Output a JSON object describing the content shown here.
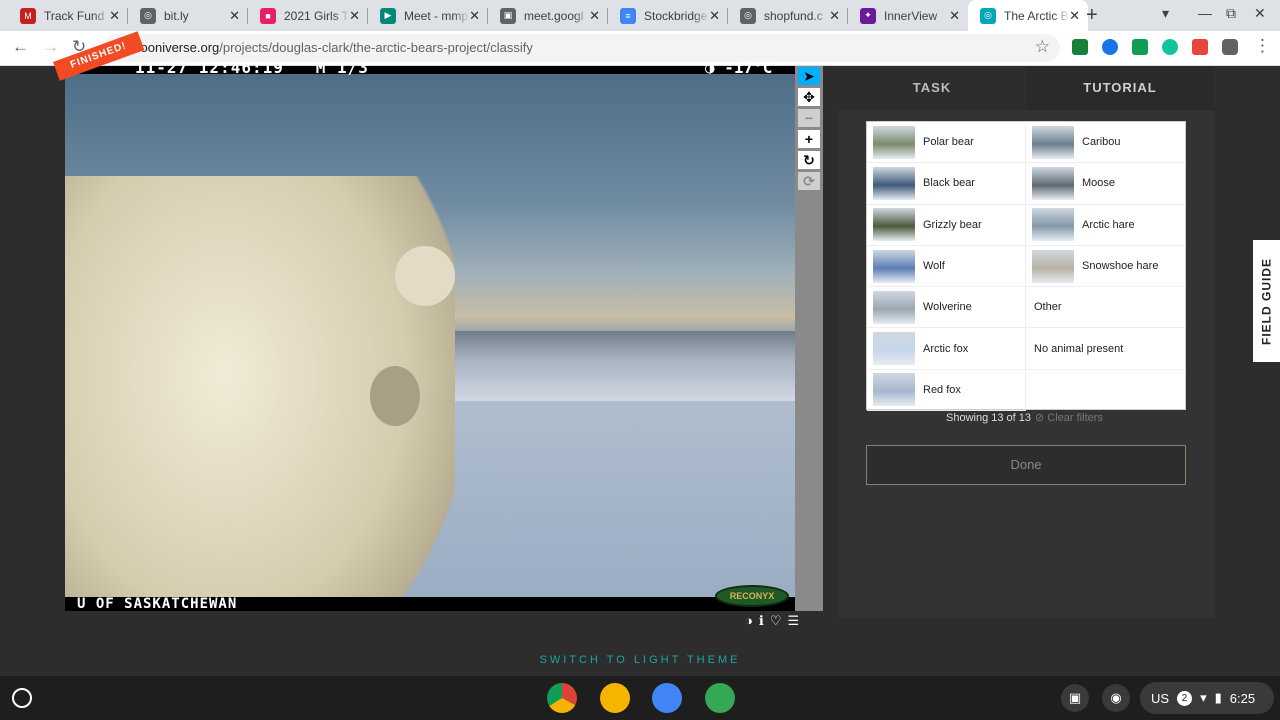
{
  "tabs": [
    {
      "label": "Track Fund",
      "favicon_color": "#c5221f",
      "favicon_glyph": "M"
    },
    {
      "label": "bit.ly",
      "favicon_color": "#5f6368",
      "favicon_glyph": "◎"
    },
    {
      "label": "2021 Girls T",
      "favicon_color": "#e91e63",
      "favicon_glyph": "■"
    },
    {
      "label": "Meet - mmp",
      "favicon_color": "#00897b",
      "favicon_glyph": "▶"
    },
    {
      "label": "meet.googl",
      "favicon_color": "#5f6368",
      "favicon_glyph": "▣"
    },
    {
      "label": "Stockbridge",
      "favicon_color": "#4285f4",
      "favicon_glyph": "≡"
    },
    {
      "label": "shopfund.c",
      "favicon_color": "#5f6368",
      "favicon_glyph": "◎"
    },
    {
      "label": "InnerView",
      "favicon_color": "#6a1b9a",
      "favicon_glyph": "✦"
    },
    {
      "label": "The Arctic B",
      "favicon_color": "#00a8b5",
      "favicon_glyph": "◎"
    }
  ],
  "tab_close": "✕",
  "newtab": "+",
  "window": {
    "minimize": "—",
    "restore": "⧉",
    "close": "✕",
    "menu": "▾"
  },
  "nav": {
    "back": "←",
    "forward": "→",
    "reload": "↻"
  },
  "address": {
    "host": "zooniverse.org",
    "path": "/projects/douglas-clark/the-arctic-bears-project/classify"
  },
  "bookmark_star": "☆",
  "subject": {
    "finished_banner": "FINISHED!",
    "timestamp": "11-27 12:46:19",
    "frame": "M 1/3",
    "temperature": "◑ -17°C",
    "credit": "U OF SASKATCHEWAN",
    "camera_logo": "RECONYX"
  },
  "image_tools": [
    {
      "name": "pointer",
      "glyph": "➤",
      "state": "selected"
    },
    {
      "name": "pan",
      "glyph": "✥",
      "state": "normal"
    },
    {
      "name": "zoom-out",
      "glyph": "−",
      "state": "disabled"
    },
    {
      "name": "zoom-in",
      "glyph": "+",
      "state": "normal"
    },
    {
      "name": "rotate",
      "glyph": "↻",
      "state": "normal"
    },
    {
      "name": "reset",
      "glyph": "⟳",
      "state": "disabled"
    }
  ],
  "subject_tools": {
    "invert": "◑",
    "info": "ℹ",
    "favorite": "♡",
    "collections": "☰"
  },
  "panel": {
    "task_tab": "TASK",
    "tutorial_tab": "TUTORIAL",
    "choices": [
      {
        "label": "Polar bear",
        "thumb": "#7a8d6a"
      },
      {
        "label": "Caribou",
        "thumb": "#6d7f8d"
      },
      {
        "label": "Black bear",
        "thumb": "#3f5a78"
      },
      {
        "label": "Moose",
        "thumb": "#5e6a72"
      },
      {
        "label": "Grizzly bear",
        "thumb": "#4d5a3c"
      },
      {
        "label": "Arctic hare",
        "thumb": "#8598a8"
      },
      {
        "label": "Wolf",
        "thumb": "#5b7fb5"
      },
      {
        "label": "Snowshoe hare",
        "thumb": "#b9b2a6"
      },
      {
        "label": "Wolverine",
        "thumb": "#9aa6b3"
      },
      {
        "label": "Other",
        "thumb": ""
      },
      {
        "label": "Arctic fox",
        "thumb": "#c7d6ea"
      },
      {
        "label": "No animal present",
        "thumb": ""
      },
      {
        "label": "Red fox",
        "thumb": "#a5b8cf"
      }
    ],
    "showing": "Showing 13 of 13",
    "clear_filters": "⊘ Clear filters",
    "done": "Done"
  },
  "field_guide": "FIELD GUIDE",
  "theme_switch": "SWITCH TO LIGHT THEME",
  "shelf": {
    "apps": [
      {
        "name": "chrome",
        "color": "#db4437"
      },
      {
        "name": "classroom",
        "color": "#f4b400"
      },
      {
        "name": "docs",
        "color": "#4285f4"
      },
      {
        "name": "play-store",
        "color": "#34a853"
      }
    ],
    "locale": "US",
    "notif_count": "2",
    "wifi": "▾",
    "battery": "▮",
    "time": "6:25"
  }
}
